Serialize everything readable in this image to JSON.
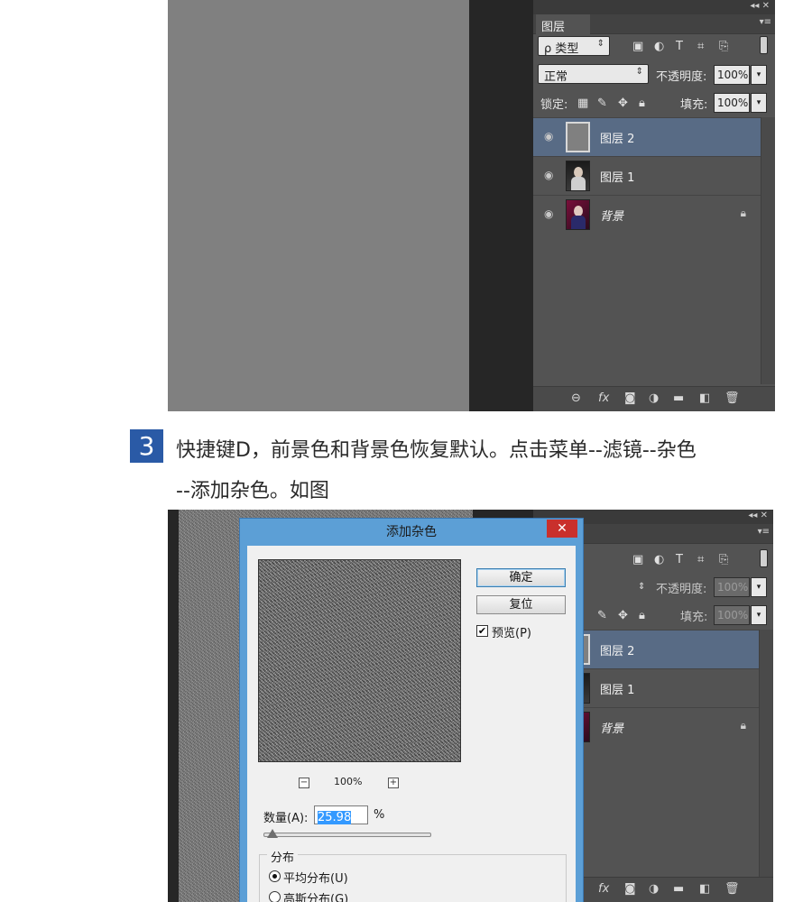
{
  "screenshot1": {
    "panel": {
      "tab": "图层",
      "top_controls": "◂◂ ✕",
      "menu_icon": "▾≡",
      "filter_kind": "ρ 类型",
      "blend_mode": "正常",
      "opacity_label": "不透明度:",
      "opacity_value": "100%",
      "lock_label": "锁定:",
      "fill_label": "填充:",
      "fill_value": "100%",
      "layers": [
        {
          "name": "图层 2",
          "selected": true
        },
        {
          "name": "图层 1",
          "selected": false
        },
        {
          "name": "背景",
          "selected": false,
          "locked": true
        }
      ]
    }
  },
  "step": {
    "number": "3",
    "line1": "快捷键D，前景色和背景色恢复默认。点击菜单--滤镜--杂色",
    "line2": "--添加杂色。如图"
  },
  "screenshot2": {
    "panel": {
      "top_controls": "◂◂ ✕",
      "menu_icon": "▾≡",
      "opacity_label": "不透明度:",
      "opacity_value": "100%",
      "fill_label": "填充:",
      "fill_value": "100%",
      "layers": [
        {
          "name": "图层 2",
          "selected": true
        },
        {
          "name": "图层 1",
          "selected": false
        },
        {
          "name": "背景",
          "selected": false,
          "locked": true
        }
      ]
    },
    "dialog": {
      "title": "添加杂色",
      "close": "✕",
      "ok_button": "确定",
      "reset_button": "复位",
      "preview_label": "预览(P)",
      "preview_checked": true,
      "zoom_out": "−",
      "zoom_value": "100%",
      "zoom_in": "+",
      "amount_label": "数量(A):",
      "amount_value": "25.98",
      "amount_unit": "%",
      "amount_slider_fraction": 0.026,
      "distribution_title": "分布",
      "distribution_options": [
        "平均分布(U)",
        "高斯分布(G)"
      ],
      "distribution_selected": "平均分布(U)"
    }
  },
  "colors": {
    "selected_layer": "#586b85",
    "dialog_frame": "#5c9fd6",
    "step_badge": "#2a5aa6",
    "close_button": "#c9302c"
  }
}
